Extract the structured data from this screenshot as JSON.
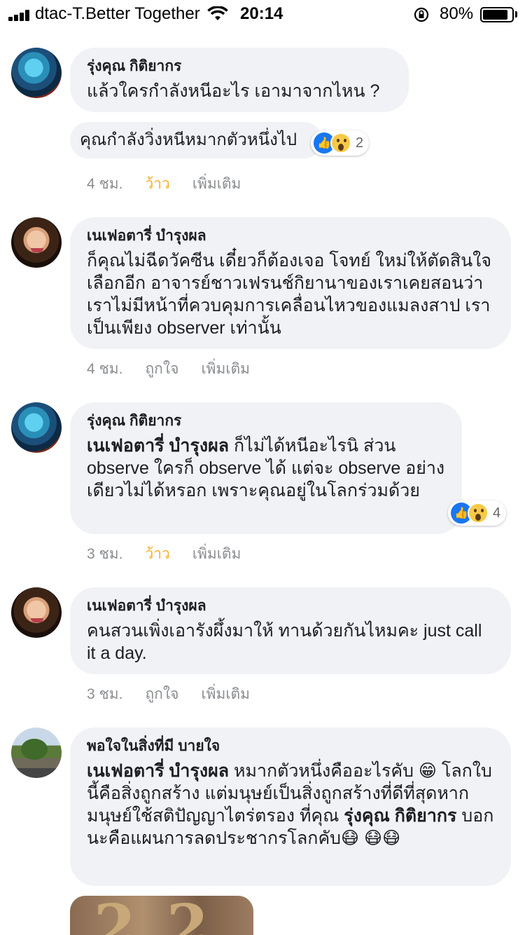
{
  "status_bar": {
    "carrier": "dtac-T.Better Together",
    "time": "20:14",
    "battery": "80%"
  },
  "comments": [
    {
      "author": "รุ่งคุณ กิติยากร",
      "text": "แล้วใครกำลังหนีอะไร เอามาจากไหน ?",
      "reply_preview": "คุณกำลังวิ่งหนีหมากตัวหนึ่งไป",
      "reaction_count": "2",
      "time": "4 ชม.",
      "like_label": "ว้าว",
      "more_label": "เพิ่มเติม"
    },
    {
      "author": "เนเฟอตารี่ บำรุงผล",
      "text": "ก็คุณไม่ฉีดวัคซีน เดี๋ยวก็ต้องเจอ โจทย์ ใหม่ให้ตัดสินใจเลือกอีก อาจารย์ชาวเฟรนช์กิยานาของเราเคยสอนว่า เราไม่มีหน้าที่ควบคุมการเคลื่อนไหวของแมลงสาป เราเป็นเพียง observer เท่านั้น",
      "time": "4 ชม.",
      "like_label": "ถูกใจ",
      "more_label": "เพิ่มเติม"
    },
    {
      "author": "รุ่งคุณ กิติยากร",
      "mention": "เนเฟอตารี่ บำรุงผล",
      "text": "ก็ไม่ได้หนีอะไรนิ ส่วน observe ใครก็ observe ได้ แต่จะ observe อย่างเดียวไม่ได้หรอก เพราะคุณอยู่ในโลกร่วมด้วย",
      "reaction_count": "4",
      "time": "3 ชม.",
      "like_label": "ว้าว",
      "more_label": "เพิ่มเติม"
    },
    {
      "author": "เนเฟอตารี่ บำรุงผล",
      "text": "คนสวนเพิ่งเอารังผึ้งมาให้ ทานด้วยกันไหมคะ just call it a day.",
      "time": "3 ชม.",
      "like_label": "ถูกใจ",
      "more_label": "เพิ่มเติม"
    },
    {
      "author": "พอใจในสิ่งที่มี บายใจ",
      "mention": "เนเฟอตารี่ บำรุงผล",
      "text_a": "หมากตัวหนึ่งคืออะไรคับ 😁 โลกใบนี้คือสิ่งถูกสร้าง แต่มนุษย์เป็นสิ่งถูกสร้างที่ดีที่สุดหากมนุษย์ใช้สติปัญญาไตร่ตรอง ที่คุณ",
      "mention2": "รุ่งคุณ กิติยากร",
      "text_b": "บอกนะคือแผนการลดประชากรโลกคับ😷 😷😷"
    }
  ]
}
